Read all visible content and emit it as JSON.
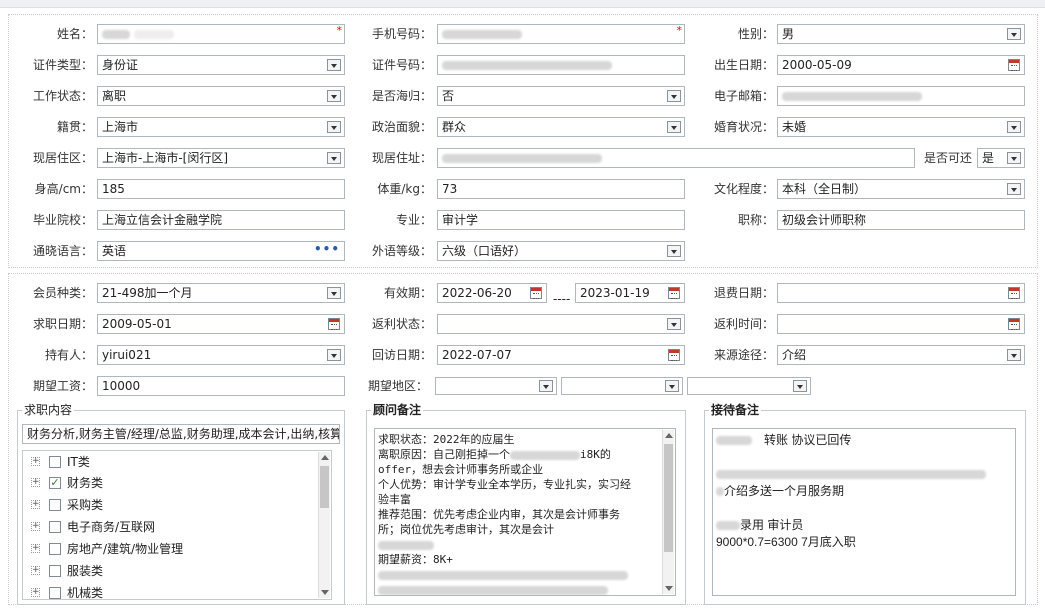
{
  "basic": {
    "name": {
      "label": "姓名："
    },
    "phone": {
      "label": "手机号码："
    },
    "gender": {
      "label": "性别：",
      "value": "男"
    },
    "id_type": {
      "label": "证件类型：",
      "value": "身份证"
    },
    "id_no": {
      "label": "证件号码："
    },
    "birth": {
      "label": "出生日期：",
      "value": "2000-05-09"
    },
    "work_status": {
      "label": "工作状态：",
      "value": "离职"
    },
    "overseas": {
      "label": "是否海归：",
      "value": "否"
    },
    "email": {
      "label": "电子邮箱："
    },
    "native": {
      "label": "籍贯：",
      "value": "上海市"
    },
    "politics": {
      "label": "政治面貌：",
      "value": "群众"
    },
    "marital": {
      "label": "婚育状况：",
      "value": "未婚"
    },
    "residence": {
      "label": "现居住区：",
      "value": "上海市-上海市-[闵行区]"
    },
    "address": {
      "label": "现居住址："
    },
    "visit": {
      "label": "是否可还",
      "value": "是"
    },
    "height": {
      "label": "身高/cm：",
      "value": "185"
    },
    "weight": {
      "label": "体重/kg：",
      "value": "73"
    },
    "education": {
      "label": "文化程度：",
      "value": "本科（全日制）"
    },
    "school": {
      "label": "毕业院校：",
      "value": "上海立信会计金融学院"
    },
    "major": {
      "label": "专业：",
      "value": "审计学"
    },
    "title": {
      "label": "职称：",
      "value": "初级会计师职称"
    },
    "language": {
      "label": "通晓语言：",
      "value": "英语"
    },
    "lang_level": {
      "label": "外语等级：",
      "value": "六级（口语好）"
    }
  },
  "member": {
    "type": {
      "label": "会员种类：",
      "value": "21-498加一个月"
    },
    "validity": {
      "label": "有效期：",
      "from": "2022-06-20",
      "sep": "----",
      "to": "2023-01-19"
    },
    "refund_date": {
      "label": "退费日期："
    },
    "job_date": {
      "label": "求职日期：",
      "value": "2009-05-01"
    },
    "rebate_status": {
      "label": "返利状态："
    },
    "rebate_time": {
      "label": "返利时间："
    },
    "holder": {
      "label": "持有人：",
      "value": "yirui021"
    },
    "revisit": {
      "label": "回访日期：",
      "value": "2022-07-07"
    },
    "source": {
      "label": "来源途径：",
      "value": "介绍"
    },
    "salary": {
      "label": "期望工资：",
      "value": "10000"
    },
    "region": {
      "label": "期望地区："
    }
  },
  "job_content": {
    "legend": "求职内容",
    "selected": "财务分析,财务主管/经理/总监,财务助理,成本会计,出纳,核算",
    "tree": [
      {
        "label": "IT类",
        "checked": false
      },
      {
        "label": "财务类",
        "checked": true
      },
      {
        "label": "采购类",
        "checked": false
      },
      {
        "label": "电子商务/互联网",
        "checked": false
      },
      {
        "label": "房地产/建筑/物业管理",
        "checked": false
      },
      {
        "label": "服装类",
        "checked": false
      },
      {
        "label": "机械类",
        "checked": false
      }
    ]
  },
  "advisor_notes": {
    "legend": "顾问备注",
    "l1": "求职状态：2022年的应届生",
    "l2a": "离职原因：自己刚拒掉一个",
    "l2b": "i8K的",
    "l3": "offer，想去会计师事务所或企业",
    "l4": "个人优势：审计学专业全本学历，专业扎实，实习经",
    "l5": "验丰富",
    "l6": "推荐范围：优先考虑企业内审，其次是会计师事务",
    "l7": "所；岗位优先考虑审计，其次是会计",
    "l9": "期望薪资：8K+"
  },
  "reception_notes": {
    "legend": "接待备注",
    "l1": "转账 协议已回传",
    "l3": "介绍多送一个月服务期",
    "l5": "录用 审计员",
    "l6": "9000*0.7=6300  7月底入职"
  },
  "icons": {
    "expand": "+",
    "check": "✓"
  }
}
